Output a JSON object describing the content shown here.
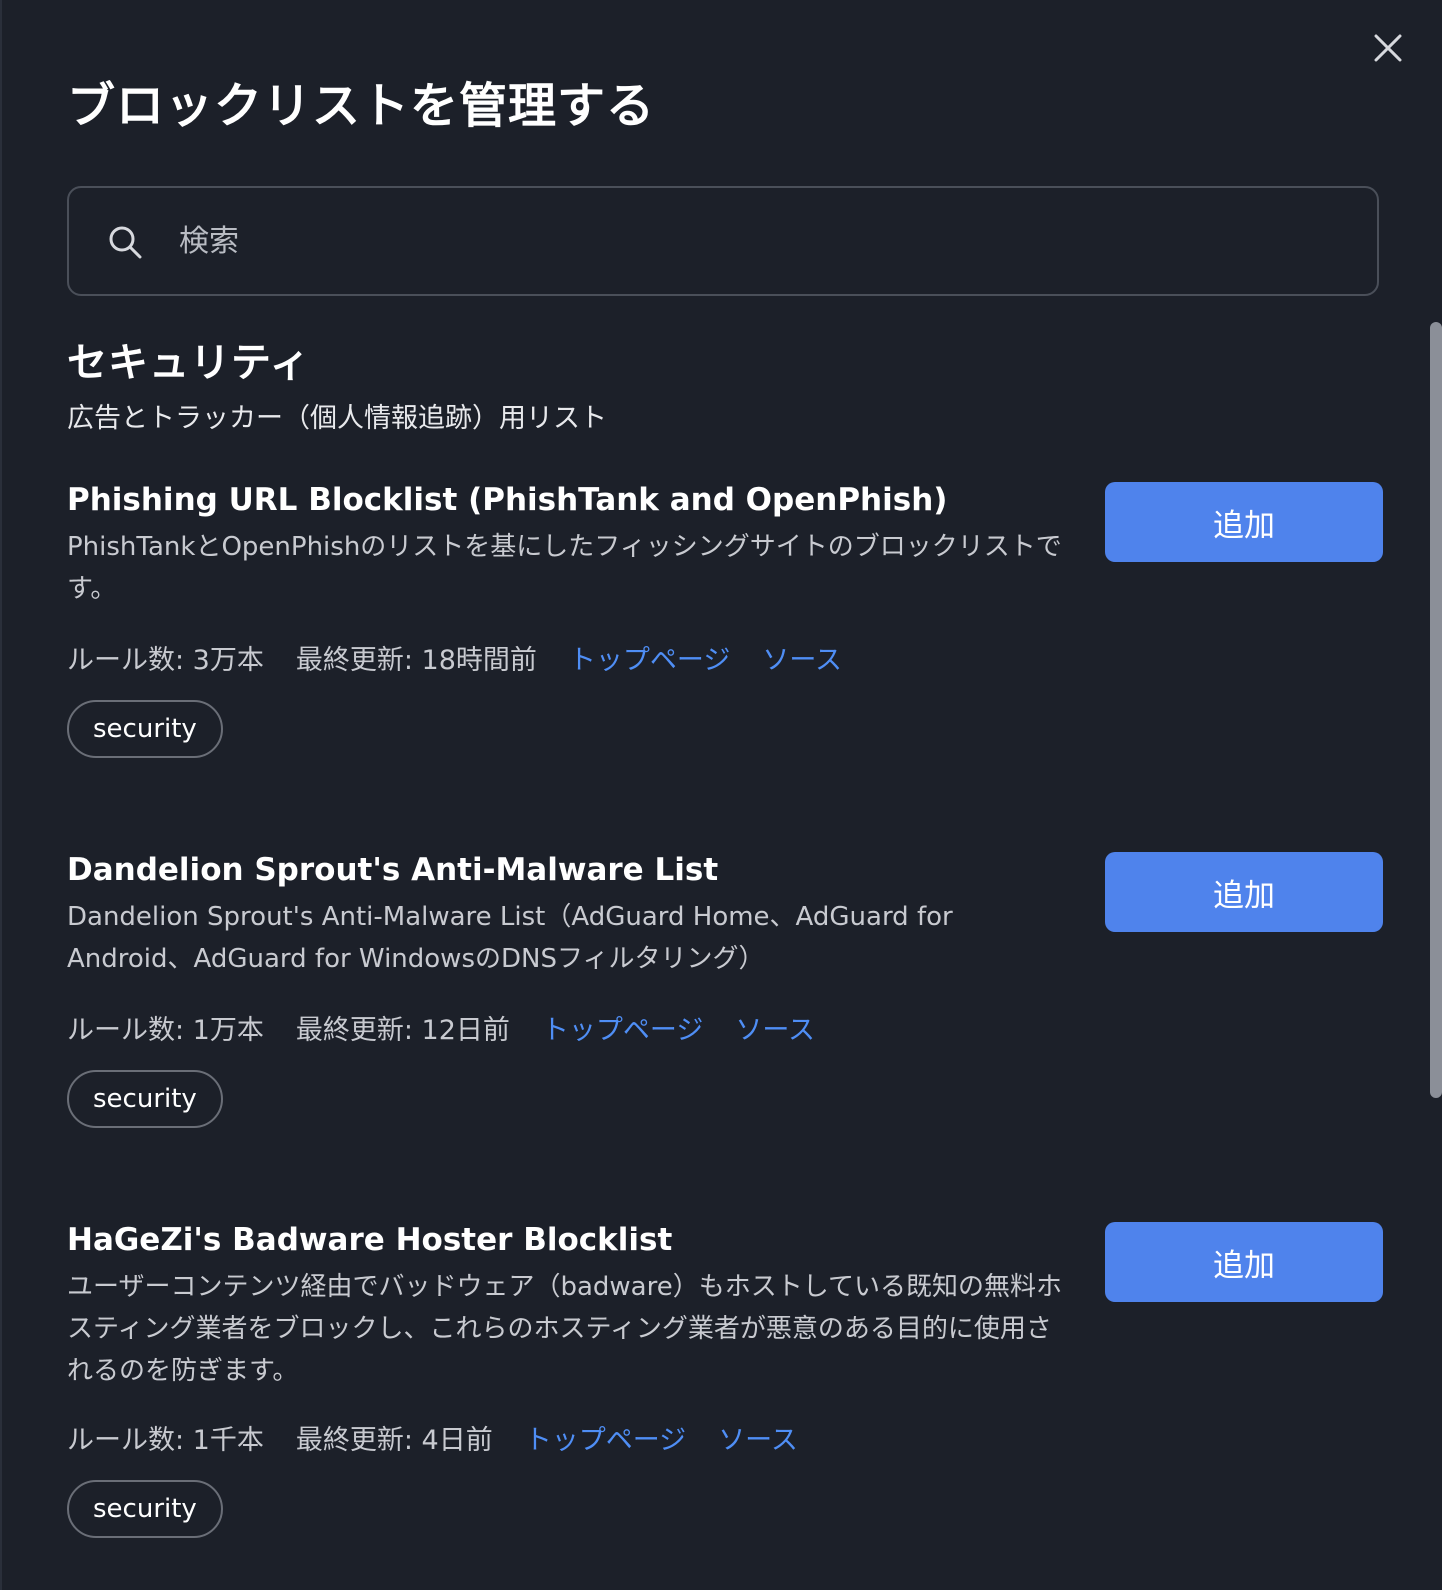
{
  "dialog": {
    "title": "ブロックリストを管理する",
    "close_icon": "close-icon"
  },
  "search": {
    "placeholder": "検索",
    "value": "",
    "icon": "search-icon"
  },
  "section": {
    "title": "セキュリティ",
    "description": "広告とトラッカー（個人情報追跡）用リスト"
  },
  "lists": [
    {
      "name": "Phishing URL Blocklist (PhishTank and OpenPhish)",
      "description": "PhishTankとOpenPhishのリストを基にしたフィッシングサイトのブロックリストです。",
      "rules": "ルール数: 3万本",
      "updated": "最終更新: 18時間前",
      "homepage": "トップページ",
      "source": "ソース",
      "tag": "security",
      "button": "追加"
    },
    {
      "name": "Dandelion Sprout's Anti-Malware List",
      "description": "Dandelion Sprout's Anti-Malware List（AdGuard Home、AdGuard for Android、AdGuard for WindowsのDNSフィルタリング）",
      "rules": "ルール数: 1万本",
      "updated": "最終更新: 12日前",
      "homepage": "トップページ",
      "source": "ソース",
      "tag": "security",
      "button": "追加"
    },
    {
      "name": "HaGeZi's Badware Hoster Blocklist",
      "description": "ユーザーコンテンツ経由でバッドウェア（badware）もホストしている既知の無料ホスティング業者をブロックし、これらのホスティング業者が悪意のある目的に使用されるのを防ぎます。",
      "rules": "ルール数: 1千本",
      "updated": "最終更新: 4日前",
      "homepage": "トップページ",
      "source": "ソース",
      "tag": "security",
      "button": "追加"
    }
  ],
  "colors": {
    "background": "#1c2029",
    "accent": "#4f83ec",
    "link": "#4f8ef5"
  }
}
